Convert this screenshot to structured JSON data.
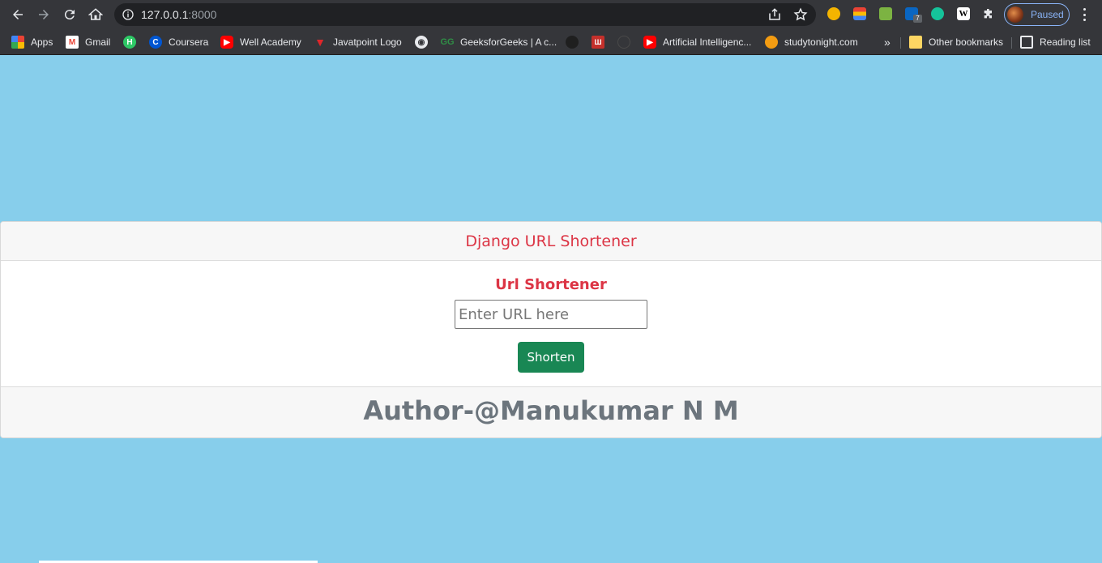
{
  "browser": {
    "url_host": "127.0.0.1",
    "url_port": ":8000",
    "profile_label": "Paused",
    "extensions": [
      "glasses-extension-icon",
      "color-picker-extension-icon",
      "print-extension-icon",
      "linkedin-extension-icon",
      "grammarly-extension-icon",
      "wikipedia-extension-icon",
      "puzzle-icon"
    ],
    "extension_badge": "7",
    "colors": {
      "chrome_bg": "#35363a",
      "omnibox_bg": "#202124",
      "profile_accent": "#8ab4f8"
    }
  },
  "bookmarks": {
    "items": [
      {
        "label": "Apps",
        "icon": "apps-grid-icon"
      },
      {
        "label": "Gmail",
        "icon": "gmail-icon"
      },
      {
        "label": "",
        "icon": "hackerrank-icon",
        "glyph": "H"
      },
      {
        "label": "Coursera",
        "icon": "coursera-icon",
        "glyph": "C"
      },
      {
        "label": "Well Academy",
        "icon": "youtube-icon"
      },
      {
        "label": "Javatpoint Logo",
        "icon": "javatpoint-icon"
      },
      {
        "label": "",
        "icon": "globe-icon"
      },
      {
        "label": "GeeksforGeeks | A c...",
        "icon": "geeksforgeeks-icon"
      },
      {
        "label": "",
        "icon": "github-icon"
      },
      {
        "label": "",
        "icon": "mathworks-icon"
      },
      {
        "label": "",
        "icon": "circle-icon"
      },
      {
        "label": "Artificial Intelligenc...",
        "icon": "youtube-icon"
      },
      {
        "label": "studytonight.com",
        "icon": "studytonight-icon"
      }
    ],
    "overflow": "»",
    "other": "Other bookmarks",
    "reading_list": "Reading list"
  },
  "page": {
    "header_title": "Django URL Shortener",
    "form_title": "Url Shortener",
    "input_placeholder": "Enter URL here",
    "input_value": "",
    "button_label": "Shorten",
    "footer_text": "Author-@Manukumar N M",
    "colors": {
      "background": "#87CEEB",
      "accent_red": "#dc3545",
      "button_green": "#198754",
      "footer_text": "#6c757d"
    }
  }
}
